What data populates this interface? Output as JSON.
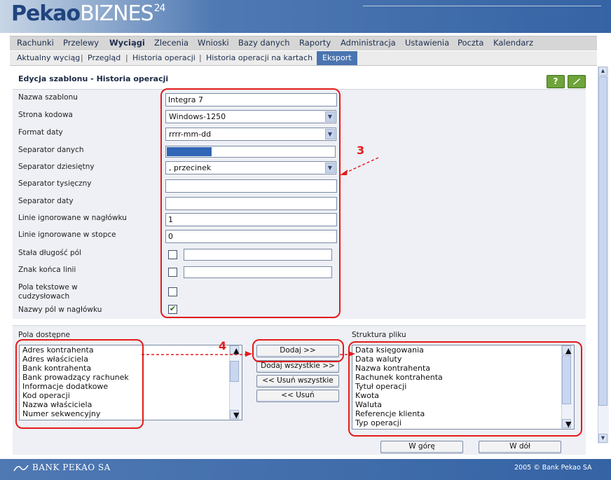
{
  "header": {
    "logo_pekao": "Pekao",
    "logo_biznes": "BIZNES",
    "logo_sup": "24"
  },
  "main_menu": [
    "Rachunki",
    "Przelewy",
    "Wyciągi",
    "Zlecenia",
    "Wnioski",
    "Bazy danych",
    "Raporty",
    "Administracja",
    "Ustawienia",
    "Poczta",
    "Kalendarz"
  ],
  "main_menu_active": "Wyciągi",
  "sub_menu": [
    "Aktualny wyciąg",
    "Przegląd",
    "Historia operacji",
    "Historia operacji na kartach",
    "Eksport"
  ],
  "sub_menu_active": "Eksport",
  "sub_menu_separator": "|",
  "page_title": "Edycja szablonu - Historia operacji",
  "icons": {
    "help": "?",
    "edit": "pencil-icon"
  },
  "form": {
    "labels": {
      "name": "Nazwa szablonu",
      "codepage": "Strona kodowa",
      "date_format": "Format daty",
      "data_sep": "Separator danych",
      "decimal_sep": "Separator dziesiętny",
      "thousands_sep": "Separator tysięczny",
      "date_sep": "Separator daty",
      "header_lines": "Linie ignorowane w nagłówku",
      "footer_lines": "Linie ignorowane w stopce",
      "fixed_width": "Stała długość pól",
      "eol": "Znak końca linii",
      "quoted_1": "Pola tekstowe w",
      "quoted_2": "cudzysłowach",
      "header_names": "Nazwy pól w nagłówku"
    },
    "values": {
      "name": "Integra 7",
      "codepage": "Windows-1250",
      "date_format": "rrrr-mm-dd",
      "data_sep": "",
      "decimal_sep": ", przecinek",
      "thousands_sep": "",
      "date_sep": "",
      "header_lines": "1",
      "footer_lines": "0"
    },
    "checkboxes": {
      "fixed_width": false,
      "eol": false,
      "quoted": false,
      "header_names": true
    }
  },
  "available": {
    "label": "Pola dostępne",
    "items": [
      "Adres kontrahenta",
      "Adres właściciela",
      "Bank kontrahenta",
      "Bank prowadzący rachunek",
      "Informacje dodatkowe",
      "Kod operacji",
      "Nazwa właściciela",
      "Numer sekwencyjny"
    ]
  },
  "structure": {
    "label": "Struktura pliku",
    "items": [
      "Data księgowania",
      "Data waluty",
      "Nazwa kontrahenta",
      "Rachunek kontrahenta",
      "Tytuł operacji",
      "Kwota",
      "Waluta",
      "Referencje klienta",
      "Typ operacji"
    ]
  },
  "buttons": {
    "add": "Dodaj >>",
    "add_all": "Dodaj wszystkie >>",
    "remove_all": "<< Usuń wszystkie",
    "remove": "<< Usuń",
    "up": "W górę",
    "down": "W dół"
  },
  "annotations": {
    "n3": "3",
    "n4": "4",
    "color": "#e41b1b"
  },
  "footer": {
    "bank": "BANK PEKAO SA",
    "copyright": "2005 © Bank Pekao SA"
  }
}
